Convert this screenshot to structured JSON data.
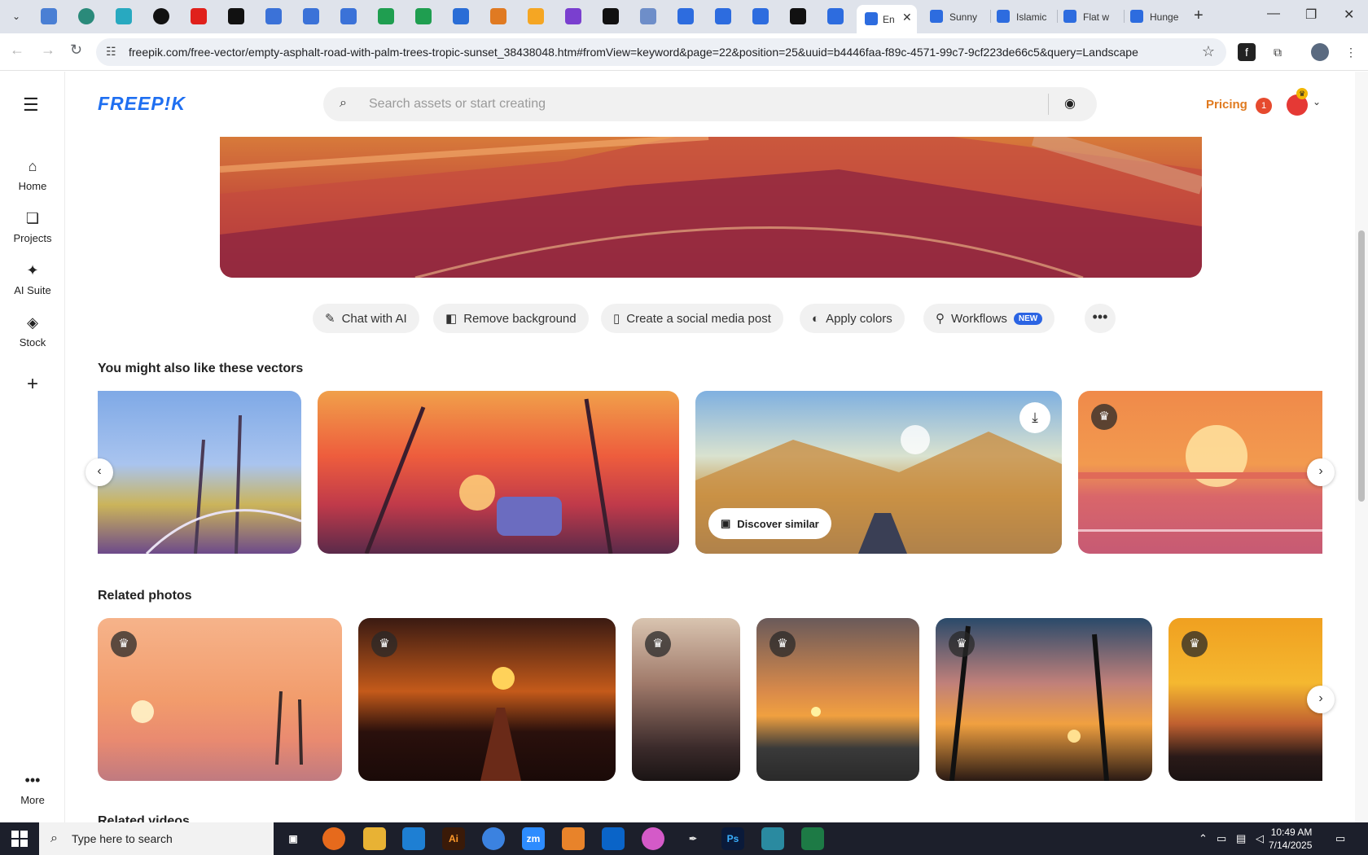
{
  "browser": {
    "tabs": [
      {
        "title": "En",
        "active": true
      },
      {
        "title": "Sunny"
      },
      {
        "title": "Islamic"
      },
      {
        "title": "Flat w"
      },
      {
        "title": "Hunge"
      }
    ],
    "url": "freepik.com/free-vector/empty-asphalt-road-with-palm-trees-tropic-sunset_38438048.htm#fromView=keyword&page=22&position=25&uuid=b4446faa-f89c-4571-99c7-9cf223de66c5&query=Landscape"
  },
  "sidebar": {
    "items": [
      {
        "label": "Home",
        "icon": "home-icon"
      },
      {
        "label": "Projects",
        "icon": "projects-icon"
      },
      {
        "label": "AI Suite",
        "icon": "sparkle-icon"
      },
      {
        "label": "Stock",
        "icon": "stock-icon"
      },
      {
        "label": "More",
        "icon": "more-dots-icon"
      }
    ]
  },
  "header": {
    "logo": "FREEP!K",
    "search_placeholder": "Search assets or start creating",
    "pricing": "Pricing",
    "notification_count": "1"
  },
  "actions": [
    {
      "label": "Chat with AI",
      "icon": "chat-ai-icon"
    },
    {
      "label": "Remove background",
      "icon": "remove-bg-icon"
    },
    {
      "label": "Create a social media post",
      "icon": "phone-icon"
    },
    {
      "label": "Apply colors",
      "icon": "palette-icon"
    },
    {
      "label": "Workflows",
      "icon": "workflow-icon",
      "badge": "NEW"
    }
  ],
  "sections": {
    "vectors_title": "You might also like these vectors",
    "photos_title": "Related photos",
    "videos_title": "Related videos"
  },
  "vector_card": {
    "discover_label": "Discover similar"
  },
  "taskbar": {
    "search_text": "Type here to search",
    "time": "10:49 AM",
    "date": "7/14/2025"
  },
  "colors": {
    "brand": "#1f6ff1",
    "pricing": "#e07a1f",
    "new_badge": "#2b64e3"
  }
}
